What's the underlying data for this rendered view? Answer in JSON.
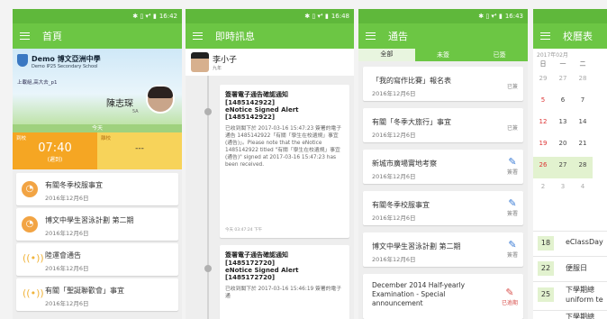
{
  "status": {
    "s1": "16:42",
    "s2": "16:48",
    "s3": "16:43",
    "icons": "✱ ▯ ▾⁴ ▮"
  },
  "s1": {
    "title": "首頁",
    "school": "Demo 博文亞洲中學",
    "school_en": "Demo IP25 Secondary School",
    "class": "上載組,高大去_p1",
    "student": "陳志琛",
    "student_sub": "5A",
    "today": "今天",
    "in_label": "到校",
    "out_label": "離校",
    "in_time": "07:40",
    "in_note": "(遲到)",
    "out_time": "---",
    "items": [
      {
        "title": "有關冬季校服事宜",
        "date": "2016年12月6日"
      },
      {
        "title": "博文中學生習泳計劃 第二期",
        "date": "2016年12月6日"
      },
      {
        "title": "陸運會通告",
        "date": "2016年12月6日"
      },
      {
        "title": "有關「聖誕聯歡會」事宜",
        "date": "2016年12月6日"
      }
    ]
  },
  "s2": {
    "title": "即時訊息",
    "sender": "李小子",
    "sender_sub": "九年",
    "msgs": [
      {
        "t1": "簽署電子通告確認通知",
        "t2": "[1485142922]",
        "t3": "eNotice Signed Alert",
        "t4": "[1485142922]",
        "body": "已收到閣下於 2017-03-16 15:47:23 簽署的電子通告 1485142922「有關「學生在校遺規」事宜 (通告)」。Please note that the eNotice 1485142922 titled \"有關「學生在校遺規」事宜 (通告)\" signed at 2017-03-16 15:47:23 has been received.",
        "time": "今天 03:47:24 下午"
      },
      {
        "t1": "簽署電子通告確認通知",
        "t2": "[1485172720]",
        "t3": "eNotice Signed Alert",
        "t4": "[1485172720]",
        "body": "已收到閣下於 2017-03-16 15:46:19 簽署的電子通",
        "time": ""
      }
    ]
  },
  "s3": {
    "title": "通告",
    "tabs": [
      "全部",
      "未簽",
      "已簽"
    ],
    "items": [
      {
        "title": "「我的寫作比賽」報名表",
        "date": "2016年12月6日",
        "status": "已簽",
        "icon": ""
      },
      {
        "title": "有關「冬季大旅行」事宜",
        "date": "2016年12月6日",
        "status": "已簽",
        "icon": ""
      },
      {
        "title": "新城市廣場實地考察",
        "date": "2016年12月6日",
        "status": "簽署",
        "icon": "✎"
      },
      {
        "title": "有關冬季校服事宜",
        "date": "2016年12月6日",
        "status": "簽署",
        "icon": "✎"
      },
      {
        "title": "博文中學生習泳計劃 第二期",
        "date": "2016年12月6日",
        "status": "簽署",
        "icon": "✎"
      },
      {
        "title": "December 2014 Half-yearly Examination - Special announcement",
        "date": "",
        "status": "已逾期",
        "icon": "✎"
      }
    ]
  },
  "s4": {
    "title": "校曆表",
    "month": "2017年02月",
    "weekdays": [
      "日",
      "一",
      "二"
    ],
    "rows": [
      [
        "29",
        "27",
        "28"
      ],
      [
        "5",
        "6",
        "7"
      ],
      [
        "12",
        "13",
        "14"
      ],
      [
        "19",
        "20",
        "21"
      ],
      [
        "26",
        "27",
        "28"
      ],
      [
        "2",
        "3",
        "4"
      ]
    ],
    "events": [
      {
        "day": "18",
        "title": "eClassDay"
      },
      {
        "day": "22",
        "title": "便服日"
      },
      {
        "day": "25",
        "title": "下學期總 uniform te"
      },
      {
        "day": "",
        "title": "下學期總"
      }
    ]
  }
}
